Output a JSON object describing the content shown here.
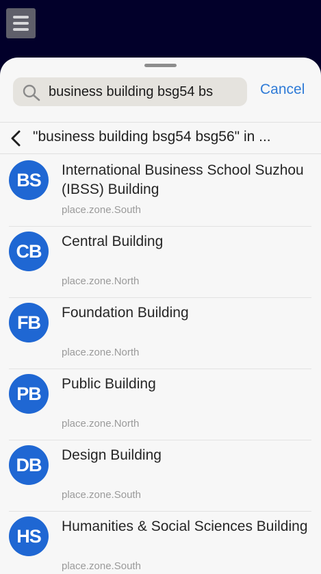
{
  "search": {
    "query": "business building bsg54 bs",
    "cancel_label": "Cancel"
  },
  "results": {
    "title": "\"business building bsg54 bsg56\" in ...",
    "items": [
      {
        "initials": "BS",
        "name": "International Business School Suzhou (IBSS) Building",
        "zone": "place.zone.South",
        "avatar_color": "#1f67d3"
      },
      {
        "initials": "CB",
        "name": "Central Building",
        "zone": "place.zone.North",
        "avatar_color": "#1f67d3"
      },
      {
        "initials": "FB",
        "name": "Foundation Building",
        "zone": "place.zone.North",
        "avatar_color": "#1f67d3"
      },
      {
        "initials": "PB",
        "name": "Public Building",
        "zone": "place.zone.North",
        "avatar_color": "#1f67d3"
      },
      {
        "initials": "DB",
        "name": "Design Building",
        "zone": "place.zone.South",
        "avatar_color": "#1f67d3"
      },
      {
        "initials": "HS",
        "name": "Humanities & Social Sciences Building",
        "zone": "place.zone.South",
        "avatar_color": "#1f67d3"
      }
    ]
  },
  "icons": {
    "menu": "hamburger-menu-icon",
    "search": "search-icon",
    "back": "chevron-left-icon"
  },
  "colors": {
    "top_bar": "#02002a",
    "accent": "#2f7bd7",
    "avatar": "#1f67d3"
  }
}
